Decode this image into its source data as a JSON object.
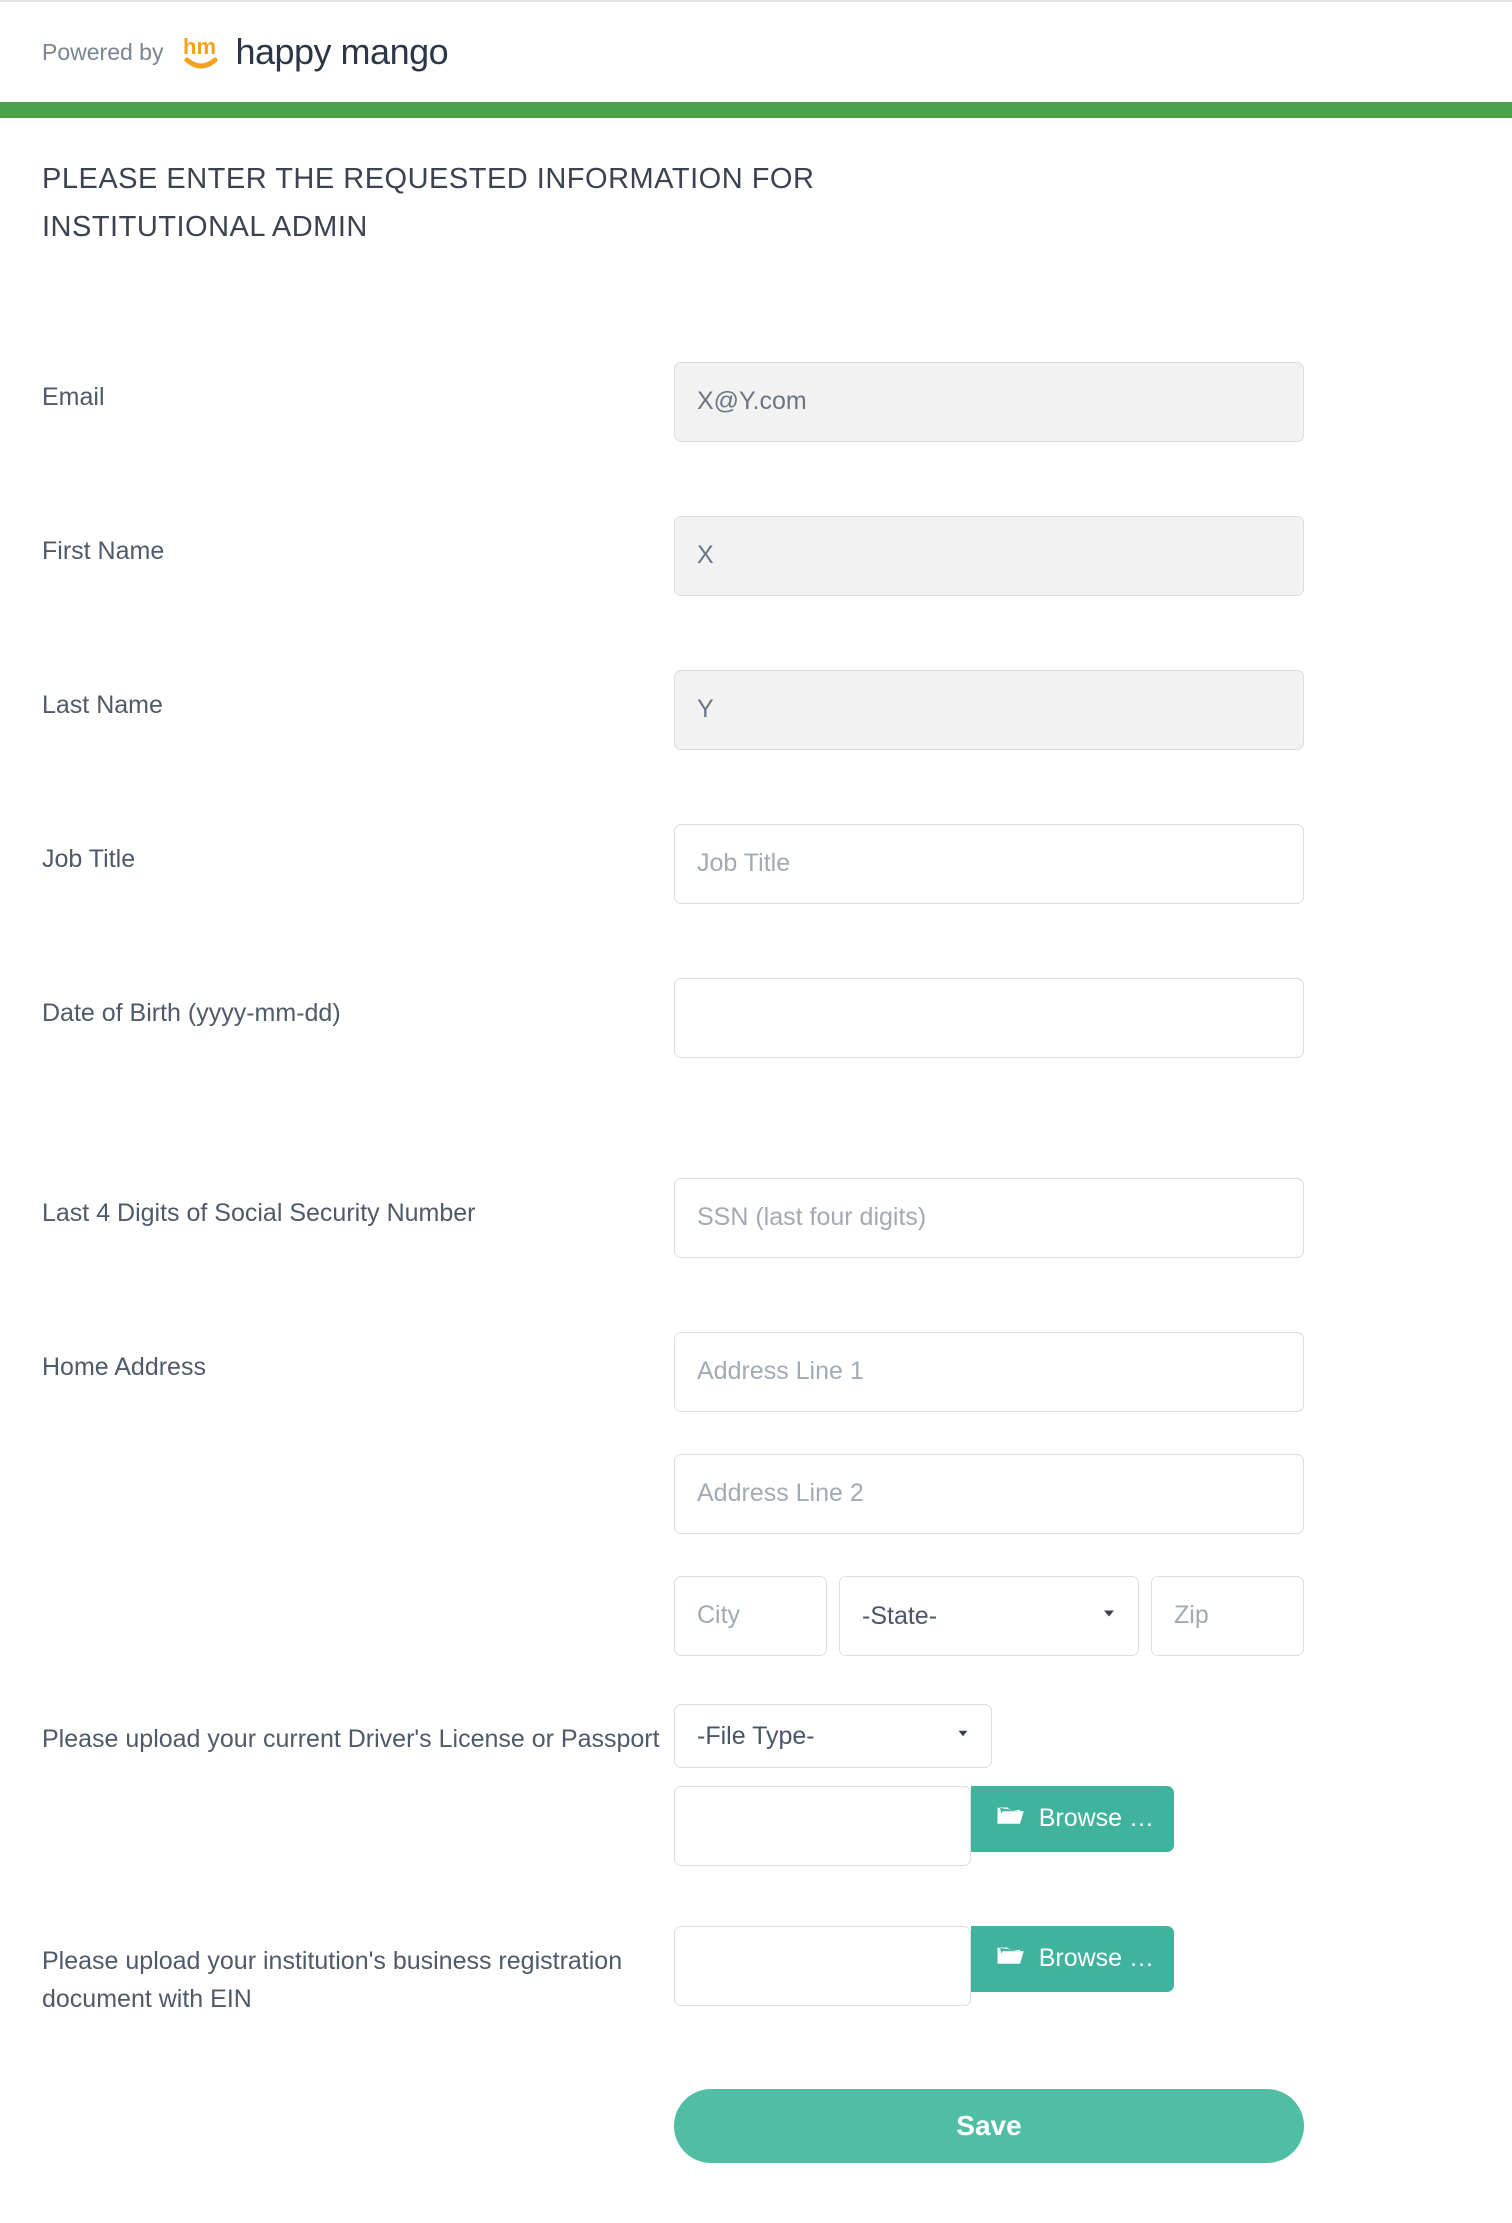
{
  "header": {
    "powered_by": "Powered by",
    "brand_text": "happy mango"
  },
  "title": "PLEASE ENTER THE REQUESTED INFORMATION FOR INSTITUTIONAL ADMIN",
  "fields": {
    "email": {
      "label": "Email",
      "value": "X@Y.com"
    },
    "first_name": {
      "label": "First Name",
      "value": "X"
    },
    "last_name": {
      "label": "Last Name",
      "value": "Y"
    },
    "job_title": {
      "label": "Job Title",
      "placeholder": "Job Title",
      "value": ""
    },
    "dob": {
      "label": "Date of Birth (yyyy-mm-dd)",
      "value": ""
    },
    "ssn": {
      "label": "Last 4 Digits of Social Security Number",
      "placeholder": "SSN (last four digits)",
      "value": ""
    },
    "address": {
      "label": "Home Address",
      "line1_placeholder": "Address Line 1",
      "line2_placeholder": "Address Line 2",
      "city_placeholder": "City",
      "state_placeholder": "-State-",
      "zip_placeholder": "Zip"
    },
    "id_upload": {
      "label": "Please upload your current Driver's License or Passport",
      "filetype_placeholder": "-File Type-",
      "browse": "Browse …"
    },
    "biz_upload": {
      "label": "Please upload your institution's business registration document with EIN",
      "browse": "Browse …"
    }
  },
  "actions": {
    "save": "Save"
  },
  "colors": {
    "green_bar": "#4aa24a",
    "teal": "#50bda5",
    "orange": "#f6a11d"
  }
}
